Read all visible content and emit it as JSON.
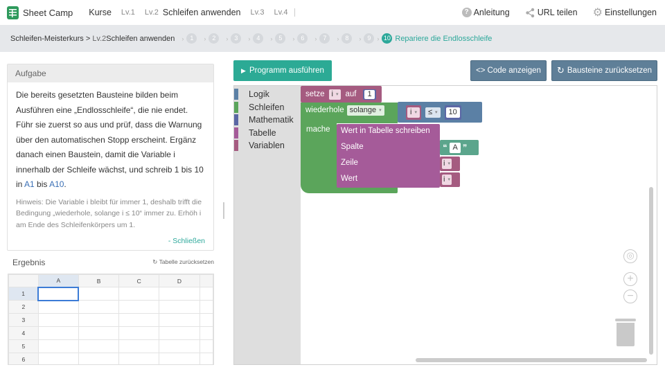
{
  "brand": {
    "name": "Sheet Camp"
  },
  "topnav": {
    "courses": "Kurse",
    "lv1": "Lv.1",
    "lv2": "Lv.2",
    "lv2_title": "Schleifen anwenden",
    "lv3": "Lv.3",
    "lv4": "Lv.4"
  },
  "toplinks": {
    "help": "Anleitung",
    "share": "URL teilen",
    "settings": "Einstellungen"
  },
  "breadcrumb": {
    "course": "Schleifen-Meisterkurs",
    "sep": " > ",
    "level": "Lv.2",
    "level_title": "Schleifen anwenden",
    "steps": [
      "1",
      "2",
      "3",
      "4",
      "5",
      "6",
      "7",
      "8",
      "9"
    ],
    "active_step": "10",
    "active_label": "Repariere die Endlosschleife"
  },
  "task": {
    "header": "Aufgabe",
    "text_a": "Die bereits gesetzten Bausteine bilden beim Ausführen eine „Endlosschleife“, die nie endet. Führ sie zuerst so aus und prüf, dass die Warnung über den automatischen Stopp erscheint. Ergänz danach einen Baustein, damit die Variable i innerhalb der Schleife wächst, und schreib 1 bis 10 in ",
    "cell_a1": "A1",
    "text_mid": " bis ",
    "cell_a10": "A10",
    "text_end": ".",
    "hint": "Hinweis: Die Variable i bleibt für immer 1, deshalb trifft die Bedingung „wiederhole, solange i ≤ 10“ immer zu. Erhöh i am Ende des Schleifenkörpers um 1.",
    "close": "- Schließen"
  },
  "result": {
    "title": "Ergebnis",
    "reset": "Tabelle zurücksetzen",
    "columns": [
      "A",
      "B",
      "C",
      "D"
    ],
    "rows": [
      "1",
      "2",
      "3",
      "4",
      "5",
      "6"
    ]
  },
  "buttons": {
    "run": "Programm ausführen",
    "code": "Code anzeigen",
    "reset_blocks": "Bausteine zurücksetzen"
  },
  "toolbox": {
    "categories": [
      {
        "label": "Logik",
        "color": "#5b80a5"
      },
      {
        "label": "Schleifen",
        "color": "#5ba55b"
      },
      {
        "label": "Mathematik",
        "color": "#5b67a5"
      },
      {
        "label": "Tabelle",
        "color": "#a55b99"
      },
      {
        "label": "Variablen",
        "color": "#a55b80"
      }
    ]
  },
  "blocks": {
    "set_kw": "setze",
    "set_var": "i",
    "set_to": "auf",
    "set_value": "1",
    "repeat_kw": "wiederhole",
    "repeat_mode": "solange",
    "cmp_var": "i",
    "cmp_op": "≤",
    "cmp_value": "10",
    "do_kw": "mache",
    "write_kw": "Wert in Tabelle schreiben",
    "col_kw": "Spalte",
    "col_value": "A",
    "row_kw": "Zeile",
    "row_var": "i",
    "val_kw": "Wert",
    "val_var": "i",
    "colors": {
      "variable": "#a55b80",
      "loop": "#5ba55b",
      "logic": "#5b80a5",
      "math": "#5b67a5",
      "sheet": "#a55b99",
      "text": "#5ba58c"
    }
  }
}
